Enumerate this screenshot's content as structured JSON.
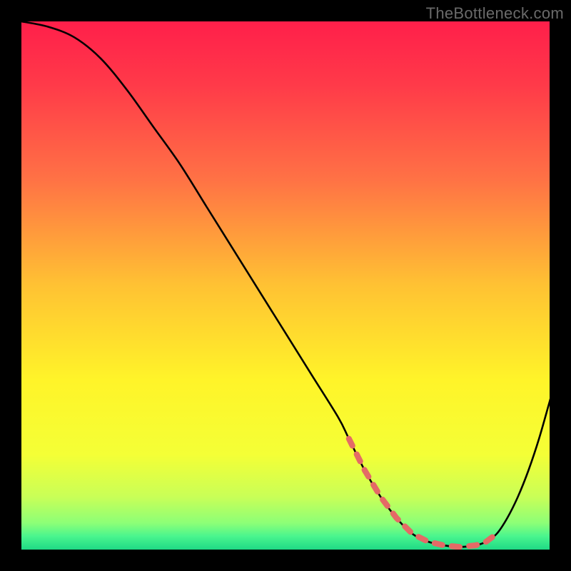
{
  "watermark": "TheBottleneck.com",
  "colors": {
    "frame_bg": "#000000",
    "watermark_text": "#6a6a6a",
    "curve_stroke": "#000000",
    "dash_stroke": "#e46a66",
    "gradient_stops": [
      {
        "offset": 0.0,
        "color": "#ff1f4a"
      },
      {
        "offset": 0.12,
        "color": "#ff3a49"
      },
      {
        "offset": 0.3,
        "color": "#ff7245"
      },
      {
        "offset": 0.5,
        "color": "#ffc233"
      },
      {
        "offset": 0.68,
        "color": "#fff429"
      },
      {
        "offset": 0.82,
        "color": "#f4ff36"
      },
      {
        "offset": 0.9,
        "color": "#c9ff57"
      },
      {
        "offset": 0.95,
        "color": "#8cff77"
      },
      {
        "offset": 0.975,
        "color": "#49f58e"
      },
      {
        "offset": 1.0,
        "color": "#1fd985"
      }
    ]
  },
  "chart_data": {
    "type": "line",
    "title": "",
    "xlabel": "",
    "ylabel": "",
    "xlim": [
      0,
      100
    ],
    "ylim": [
      0,
      100
    ],
    "series": [
      {
        "name": "bottleneck-curve",
        "x": [
          0,
          5,
          10,
          15,
          20,
          25,
          30,
          35,
          40,
          45,
          50,
          55,
          60,
          62,
          65,
          68,
          71,
          74,
          77,
          80,
          83,
          86,
          88,
          90,
          92,
          94,
          96,
          98,
          100
        ],
        "y": [
          100,
          99,
          97,
          93,
          87,
          80,
          73,
          65,
          57,
          49,
          41,
          33,
          25,
          21,
          15,
          10,
          6,
          3,
          1.5,
          0.8,
          0.5,
          0.8,
          1.5,
          3,
          6,
          10,
          15,
          21,
          28
        ]
      }
    ],
    "dash_segment": {
      "name": "optimal-range-marker",
      "x_start": 62,
      "x_end": 90
    }
  }
}
